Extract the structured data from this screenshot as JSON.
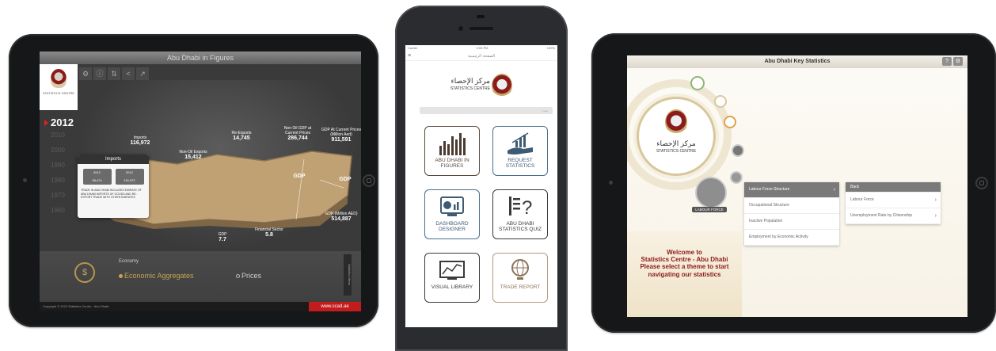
{
  "tablet1": {
    "title": "Abu Dhabi in Figures",
    "logo_text": "STATISTICS CENTRE",
    "tools": [
      "⚙",
      "ⓘ",
      "⇅",
      "<",
      "↗"
    ],
    "years": [
      "2012",
      "2010",
      "2000",
      "1990",
      "1980",
      "1970",
      "1960"
    ],
    "map_labels": [
      {
        "label": "Imports",
        "value": "116,972"
      },
      {
        "label": "Non-Oil Exports",
        "value": "15,412"
      },
      {
        "label": "Re-Exports",
        "value": "14,745"
      },
      {
        "label": "Non Oil GDP at Current Prices",
        "value": "286,744"
      },
      {
        "label": "GDP At Current Prices (Million Aed)",
        "value": "911,591"
      },
      {
        "label": "GDP",
        "value": ""
      },
      {
        "label": "GDP",
        "value": ""
      },
      {
        "label": "Financial Sector",
        "value": "5.8"
      },
      {
        "label": "GDP",
        "value": "7.7"
      },
      {
        "label": "GDP (Million AED)",
        "value": "514,887"
      }
    ],
    "popup": {
      "title": "Imports",
      "cells": [
        {
          "year": "2012",
          "value": "98,474"
        },
        {
          "year": "2012",
          "value": "116,972"
        }
      ],
      "note": "TRADE IN ABU DHABI INCLUDES EMIRATE OF ABU DHABI IMPORTS OF GOODS AND RE-EXPORT TRADE WITH OTHER EMIRATES"
    },
    "bottom": {
      "section": "Economy",
      "options": [
        "Economic Aggregates",
        "Prices"
      ]
    },
    "footer": "Copyright © 2013 Statistics Centre - Abu Dhabi",
    "url": "www.scad.ae",
    "side": "Statistics Menu"
  },
  "phone": {
    "status_left": "Carrier",
    "status_center": "3:00 PM",
    "status_right": "100%",
    "nav_title": "الصفحة الرئيسية",
    "logo_ar": "مركز الإحصاء",
    "logo_en": "STATISTICS CENTRE",
    "search_hint": "بحث",
    "tiles": [
      {
        "label": "ABU DHABI IN FIGURES",
        "style": "brown"
      },
      {
        "label": "REQUEST STATISTICS",
        "style": "blue"
      },
      {
        "label": "DASHBOARD DESIGNER",
        "style": "blue"
      },
      {
        "label": "ABU DHABI STATISTICS QUIZ",
        "style": "dark"
      },
      {
        "label": "VISUAL LIBRARY",
        "style": "dark"
      },
      {
        "label": "TRADE REPORT",
        "style": "gold"
      }
    ]
  },
  "tablet3": {
    "title": "Abu Dhabi Key Statistics",
    "logo_ar": "مركز الإحصاء",
    "logo_en": "STATISTICS CENTRE",
    "labour_label": "LABOUR FORCE",
    "menu1": [
      "Labour Force Structure",
      "Occupational Structure",
      "Inactive Population",
      "Employment by Economic Activity"
    ],
    "menu2_header": "Back",
    "menu2": [
      "Labour Force",
      "Unemployment Rate by Citizenship"
    ],
    "welcome": [
      "Welcome to",
      "Statistics Centre - Abu Dhabi",
      "Please select a theme to start",
      "navigating our statistics"
    ]
  }
}
